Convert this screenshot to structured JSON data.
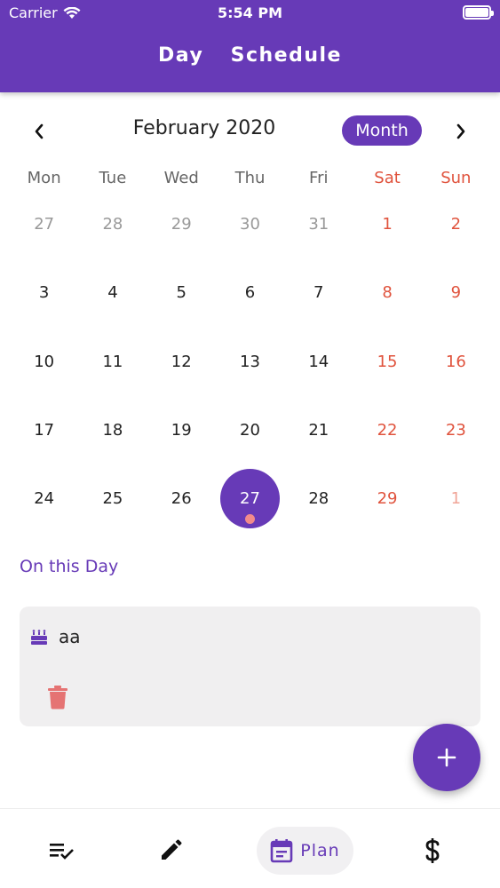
{
  "status_bar": {
    "carrier": "Carrier",
    "time": "5:54 PM"
  },
  "header": {
    "title": "Day  Schedule"
  },
  "calendar": {
    "month_label": "February 2020",
    "view_toggle": "Month",
    "weekdays": [
      "Mon",
      "Tue",
      "Wed",
      "Thu",
      "Fri",
      "Sat",
      "Sun"
    ],
    "weeks": [
      [
        "27",
        "28",
        "29",
        "30",
        "31",
        "1",
        "2"
      ],
      [
        "3",
        "4",
        "5",
        "6",
        "7",
        "8",
        "9"
      ],
      [
        "10",
        "11",
        "12",
        "13",
        "14",
        "15",
        "16"
      ],
      [
        "17",
        "18",
        "19",
        "20",
        "21",
        "22",
        "23"
      ],
      [
        "24",
        "25",
        "26",
        "27",
        "28",
        "29",
        "1"
      ]
    ],
    "selected_day": "27"
  },
  "events_section": {
    "title": "On this Day",
    "events": [
      {
        "title": "aa",
        "icon": "cake-icon"
      }
    ]
  },
  "bottom_nav": {
    "plan_label": "Plan",
    "items": [
      "checklist-icon",
      "pencil-icon",
      "calendar-icon",
      "dollar-icon"
    ]
  },
  "colors": {
    "primary": "#673ab7",
    "weekend": "#e0533d",
    "event_dot": "#f28b8b",
    "delete": "#e57373"
  }
}
